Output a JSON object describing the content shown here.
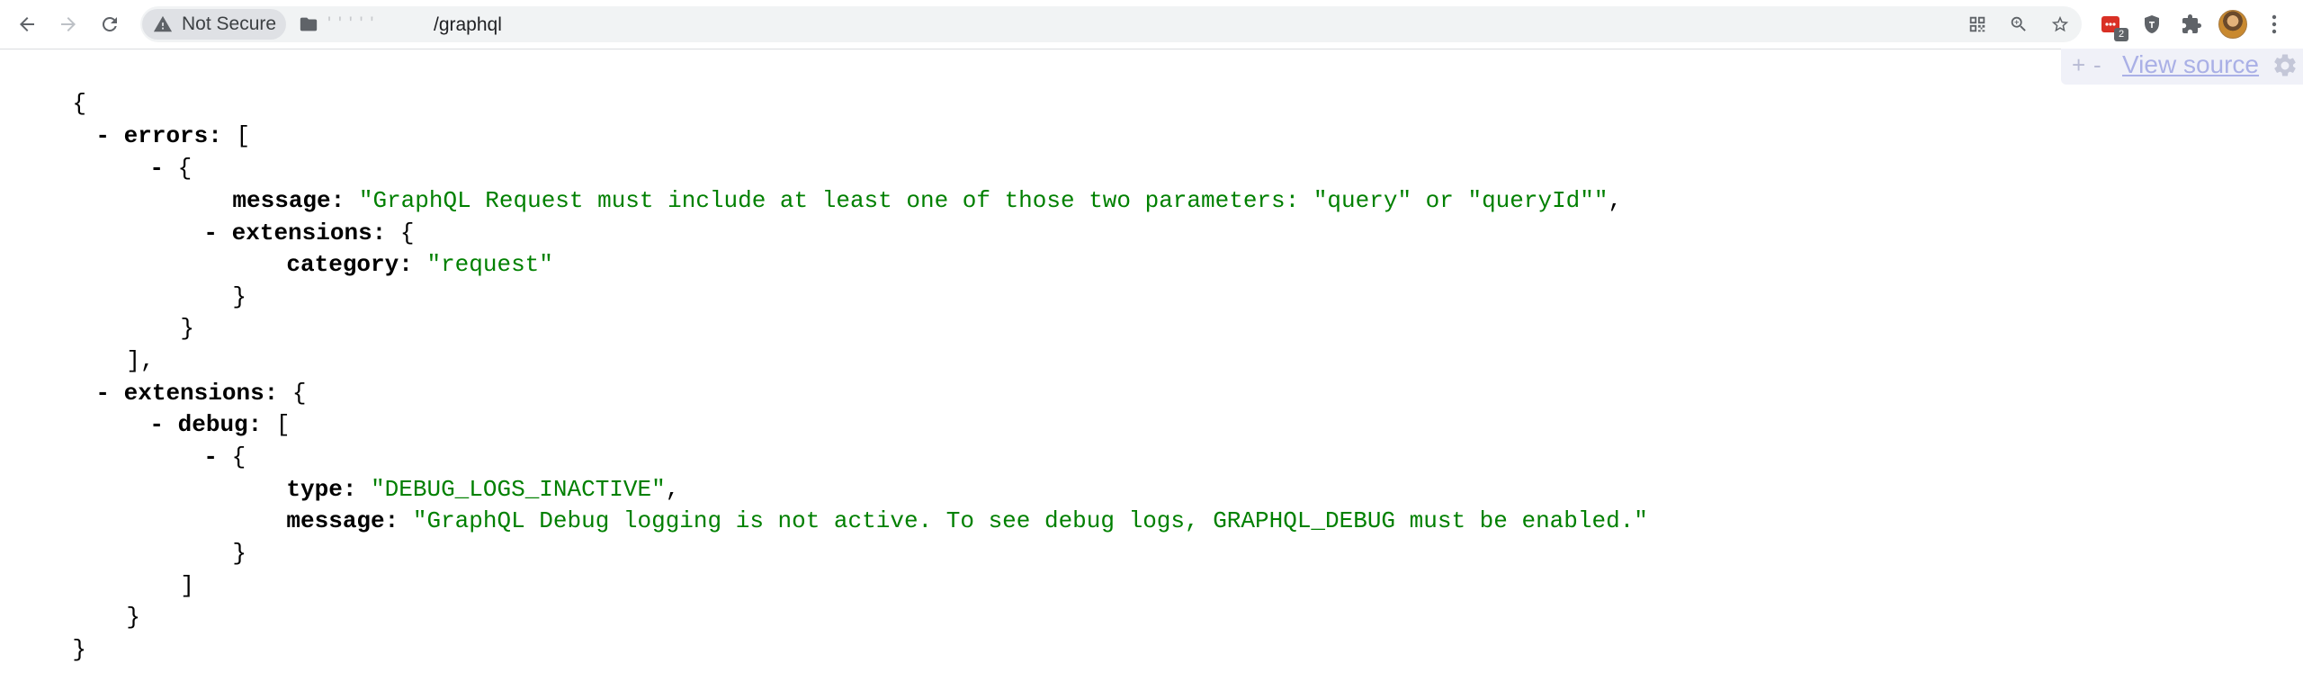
{
  "browser": {
    "security_chip_label": "Not Secure",
    "url_host_obscured": "' ' ' ' '",
    "url_path": "/graphql",
    "extension_badge": "2",
    "colors": {
      "toolbar_bg": "#ffffff",
      "omnibox_bg": "#f1f3f4",
      "extension_red": "#d93025"
    }
  },
  "viewer_panel": {
    "expand_label": "+",
    "collapse_label": "-",
    "view_source_label": "View source"
  },
  "json": {
    "lines": [
      {
        "collapse": "",
        "key": "",
        "sep": "",
        "value": "",
        "punct": "{"
      },
      {
        "collapse": "- ",
        "key": "errors",
        "sep": ": ",
        "value": "",
        "punct": "["
      },
      {
        "collapse": "- ",
        "key": "",
        "sep": "",
        "value": "",
        "punct": "{"
      },
      {
        "collapse": "",
        "key": "message",
        "sep": ": ",
        "value": "\"GraphQL Request must include at least one of those two parameters: \"query\" or \"queryId\"\"",
        "punct": ","
      },
      {
        "collapse": "- ",
        "key": "extensions",
        "sep": ": ",
        "value": "",
        "punct": "{"
      },
      {
        "collapse": "",
        "key": "category",
        "sep": ": ",
        "value": "\"request\"",
        "punct": ""
      },
      {
        "collapse": "",
        "key": "",
        "sep": "",
        "value": "",
        "punct": "}"
      },
      {
        "collapse": "",
        "key": "",
        "sep": "",
        "value": "",
        "punct": "}"
      },
      {
        "collapse": "",
        "key": "",
        "sep": "",
        "value": "",
        "punct": "],"
      },
      {
        "collapse": "- ",
        "key": "extensions",
        "sep": ": ",
        "value": "",
        "punct": "{"
      },
      {
        "collapse": "- ",
        "key": "debug",
        "sep": ": ",
        "value": "",
        "punct": "["
      },
      {
        "collapse": "- ",
        "key": "",
        "sep": "",
        "value": "",
        "punct": "{"
      },
      {
        "collapse": "",
        "key": "type",
        "sep": ": ",
        "value": "\"DEBUG_LOGS_INACTIVE\"",
        "punct": ","
      },
      {
        "collapse": "",
        "key": "message",
        "sep": ": ",
        "value": "\"GraphQL Debug logging is not active. To see debug logs, GRAPHQL_DEBUG must be enabled.\"",
        "punct": ""
      },
      {
        "collapse": "",
        "key": "",
        "sep": "",
        "value": "",
        "punct": "}"
      },
      {
        "collapse": "",
        "key": "",
        "sep": "",
        "value": "",
        "punct": "]"
      },
      {
        "collapse": "",
        "key": "",
        "sep": "",
        "value": "",
        "punct": "}"
      },
      {
        "collapse": "",
        "key": "",
        "sep": "",
        "value": "",
        "punct": "}"
      }
    ],
    "colors": {
      "string": "#008000",
      "key": "#000000"
    }
  }
}
